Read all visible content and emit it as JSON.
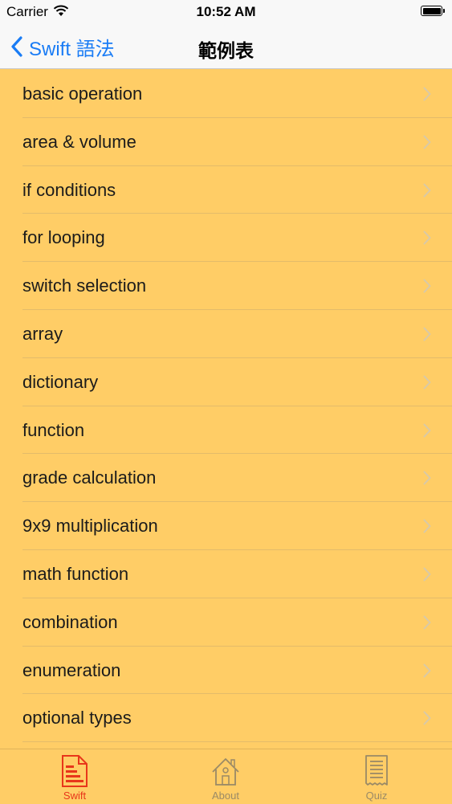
{
  "status_bar": {
    "carrier": "Carrier",
    "time": "10:52 AM"
  },
  "nav": {
    "back_label": "Swift 語法",
    "title": "範例表"
  },
  "list": {
    "items": [
      {
        "label": "basic operation"
      },
      {
        "label": "area & volume"
      },
      {
        "label": "if conditions"
      },
      {
        "label": "for looping"
      },
      {
        "label": "switch selection"
      },
      {
        "label": "array"
      },
      {
        "label": "dictionary"
      },
      {
        "label": "function"
      },
      {
        "label": "grade calculation"
      },
      {
        "label": "9x9 multiplication"
      },
      {
        "label": "math function"
      },
      {
        "label": "combination"
      },
      {
        "label": "enumeration"
      },
      {
        "label": "optional types"
      }
    ]
  },
  "tabs": [
    {
      "label": "Swift",
      "icon": "document-icon",
      "selected": true
    },
    {
      "label": "About",
      "icon": "house-icon",
      "selected": false
    },
    {
      "label": "Quiz",
      "icon": "receipt-icon",
      "selected": false
    }
  ],
  "colors": {
    "background": "#ffcd66",
    "accent": "#1a7cf5",
    "tab_selected": "#e8361a",
    "tab_unselected": "#9a8a66"
  }
}
